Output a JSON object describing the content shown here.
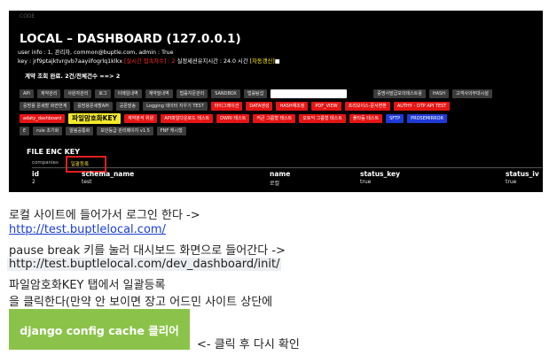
{
  "dashboard": {
    "code_tag": "CODE",
    "title": "LOCAL – DASHBOARD (127.0.0.1)",
    "info_line1": "user info : 1, 관리자, common@buptle.com, admin : True",
    "info_line2_prefix": "key : jrf9ptajktvrgvb7aayiifogrlq1klkx ",
    "info_line2_realtime": "[실시간 접속자수] : 2",
    "info_line2_mid": " 실정세션유지시간 : 24.0 시간 ",
    "info_line2_auto": "[자동갱신]",
    "info_line2_box": "■",
    "summary": "계약 조회 완료. 2건/전체건수 ==> 2",
    "row1": [
      {
        "label": "API",
        "style": ""
      },
      {
        "label": "계약관리",
        "style": ""
      },
      {
        "label": "사원자관리",
        "style": ""
      },
      {
        "label": "로그",
        "style": ""
      },
      {
        "label": "이메일내역",
        "style": ""
      },
      {
        "label": "계약밀내역",
        "style": ""
      },
      {
        "label": "법률지문관리",
        "style": ""
      },
      {
        "label": "SANDBOX",
        "style": ""
      },
      {
        "label": "법률탐섭",
        "style": ""
      },
      {
        "label": "",
        "style": "whitebox"
      },
      {
        "label": "증명서발급모의테스트용",
        "style": ""
      },
      {
        "label": "HASH",
        "style": ""
      },
      {
        "label": "고객사의부대시설",
        "style": ""
      }
    ],
    "row2": [
      {
        "label": "응방용 문세할 화면연계",
        "style": ""
      },
      {
        "label": "응방용문세할API",
        "style": ""
      },
      {
        "label": "공문발송",
        "style": ""
      },
      {
        "label": "Logging 데이터 지우기 TEST",
        "style": ""
      },
      {
        "label": "마이그레이션",
        "style": "red"
      },
      {
        "label": "DATA생성",
        "style": "red"
      },
      {
        "label": "HASH재조정",
        "style": "red"
      },
      {
        "label": "PDF_VIEW",
        "style": "red"
      },
      {
        "label": "프리모이스-문서변환",
        "style": "red"
      },
      {
        "label": "AUTHY - OTP API TEST",
        "style": "red"
      }
    ],
    "row3": [
      {
        "label": "adaty_dashboard",
        "style": "red"
      },
      {
        "label": "파일암호화KEY",
        "style": "yellow"
      },
      {
        "label": "계약분석 위원",
        "style": "red"
      },
      {
        "label": "API파일다운로드 테스트",
        "style": "red"
      },
      {
        "label": "DWRI 테스트",
        "style": "red"
      },
      {
        "label": "커큰 그룹형 테스트",
        "style": "red"
      },
      {
        "label": "오토딕 그룹형 테스트",
        "style": "red"
      },
      {
        "label": "풀타듬 테스트",
        "style": "red"
      },
      {
        "label": "SFTP",
        "style": "blue"
      },
      {
        "label": "PROSEMIRROR",
        "style": "blue"
      }
    ],
    "row4": [
      {
        "label": "E",
        "style": ""
      },
      {
        "label": "rule 초기화",
        "style": ""
      },
      {
        "label": "알림공통화",
        "style": ""
      },
      {
        "label": "보안등급 관리페이지 v1.5",
        "style": ""
      },
      {
        "label": "FNF 캐시형",
        "style": ""
      }
    ],
    "enc_title": "FILE ENC KEY",
    "tabs": [
      "companies",
      "일괄등록"
    ],
    "table": {
      "headers": [
        "id",
        "schema_name",
        "name",
        "status_key",
        "status_iv"
      ],
      "rows": [
        [
          "2",
          "test",
          "로컬",
          "true",
          "true"
        ]
      ]
    }
  },
  "instructions": {
    "line1": "로컬 사이트에 들어가서 로그인 한다 ->",
    "link1": "http://test.buptlelocal.com/",
    "line3": "pause break 키를 눌러 대시보드 화면으로 들어간다 ->",
    "url2": "http://test.buptlelocal.com/dev_dashboard/init/",
    "line5": "파일암호화KEY 탭에서 일괄등록",
    "line6": "을 클릭한다(만약 안 보이면 장고 어드민 사이트 상단에"
  },
  "cache_button": {
    "label": "django config cache 클리어",
    "color": "#8bc34a"
  },
  "cache_note": "<- 클릭 후 다시 확인",
  "colors": {
    "highlight_border": "#e02020",
    "red_button": "#e51515",
    "blue_button": "#1f3ad6",
    "yellow_button": "#f3e92b",
    "link": "#1a3fd6"
  }
}
